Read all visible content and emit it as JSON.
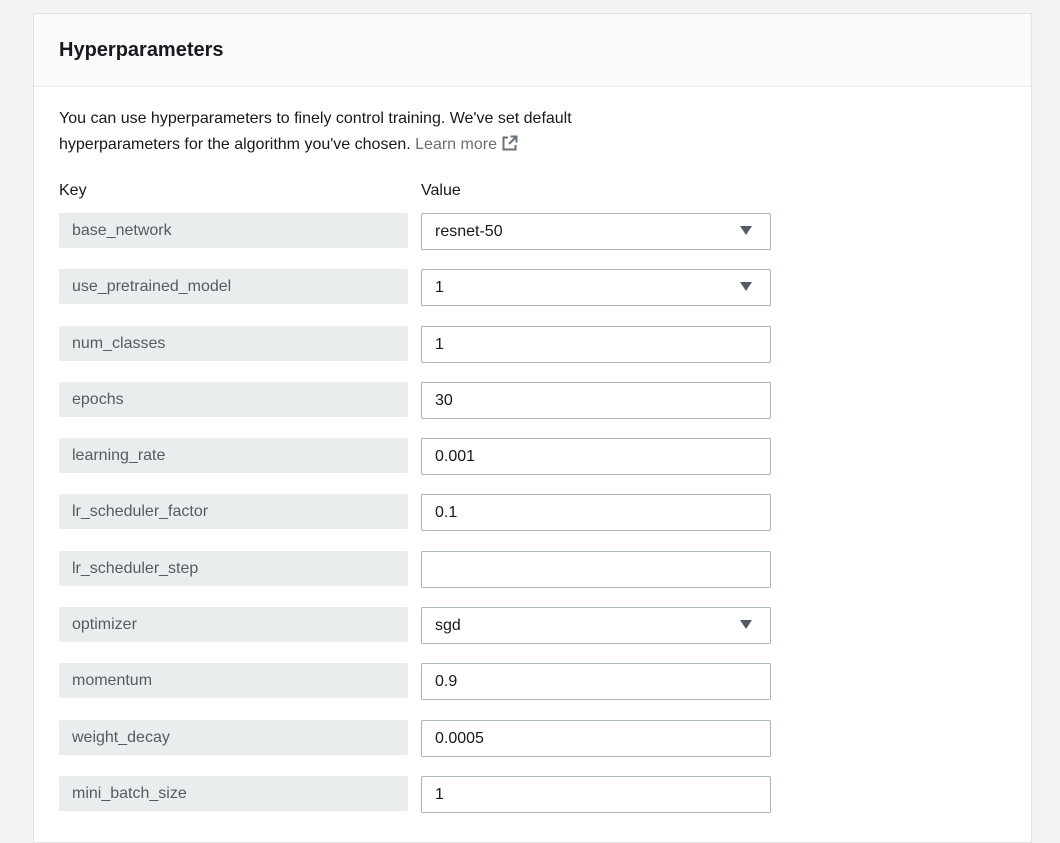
{
  "panel": {
    "title": "Hyperparameters",
    "description": "You can use hyperparameters to finely control training. We've set default hyperparameters for the algorithm you've chosen.",
    "learn_more": "Learn more",
    "learn_more_icon": "external-link-icon",
    "key_header": "Key",
    "value_header": "Value"
  },
  "hyperparameters": [
    {
      "key": "base_network",
      "value": "resnet-50",
      "type": "select"
    },
    {
      "key": "use_pretrained_model",
      "value": "1",
      "type": "select"
    },
    {
      "key": "num_classes",
      "value": "1",
      "type": "input"
    },
    {
      "key": "epochs",
      "value": "30",
      "type": "input"
    },
    {
      "key": "learning_rate",
      "value": "0.001",
      "type": "input"
    },
    {
      "key": "lr_scheduler_factor",
      "value": "0.1",
      "type": "input"
    },
    {
      "key": "lr_scheduler_step",
      "value": "",
      "type": "input"
    },
    {
      "key": "optimizer",
      "value": "sgd",
      "type": "select"
    },
    {
      "key": "momentum",
      "value": "0.9",
      "type": "input"
    },
    {
      "key": "weight_decay",
      "value": "0.0005",
      "type": "input"
    },
    {
      "key": "mini_batch_size",
      "value": "1",
      "type": "input"
    }
  ]
}
